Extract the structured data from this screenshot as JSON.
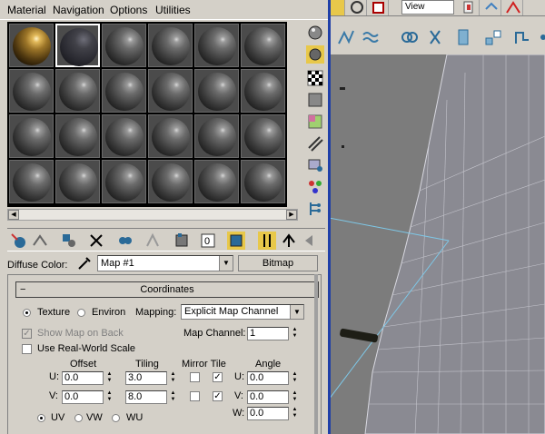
{
  "menubar": {
    "items": [
      "Material",
      "Navigation",
      "Options",
      "Utilities"
    ]
  },
  "viewport": {
    "view_select": "View"
  },
  "sample_slots": {
    "rows": 4,
    "cols": 6,
    "active_index": 1
  },
  "material": {
    "diffuse_label": "Diffuse Color:",
    "map_name": "Map #1",
    "map_type_button": "Bitmap"
  },
  "coordinates": {
    "title": "Coordinates",
    "collapse_symbol": "−",
    "texture_label": "Texture",
    "environ_label": "Environ",
    "mapping_label": "Mapping:",
    "mapping_value": "Explicit Map Channel",
    "show_map_on_back": "Show Map on Back",
    "map_channel_label": "Map Channel:",
    "map_channel_value": "1",
    "use_real_world_scale": "Use Real-World Scale",
    "col_offset": "Offset",
    "col_tiling": "Tiling",
    "col_mirror_tile": "Mirror Tile",
    "col_angle": "Angle",
    "u_label": "U:",
    "v_label": "V:",
    "w_label": "W:",
    "u_offset": "0.0",
    "v_offset": "0.0",
    "u_tiling": "3.0",
    "v_tiling": "8.0",
    "angle_u_label": "U:",
    "angle_v_label": "V:",
    "angle_u": "0.0",
    "angle_v": "0.0",
    "angle_w": "0.0",
    "uv_label": "UV",
    "vw_label": "VW",
    "wu_label": "WU"
  }
}
